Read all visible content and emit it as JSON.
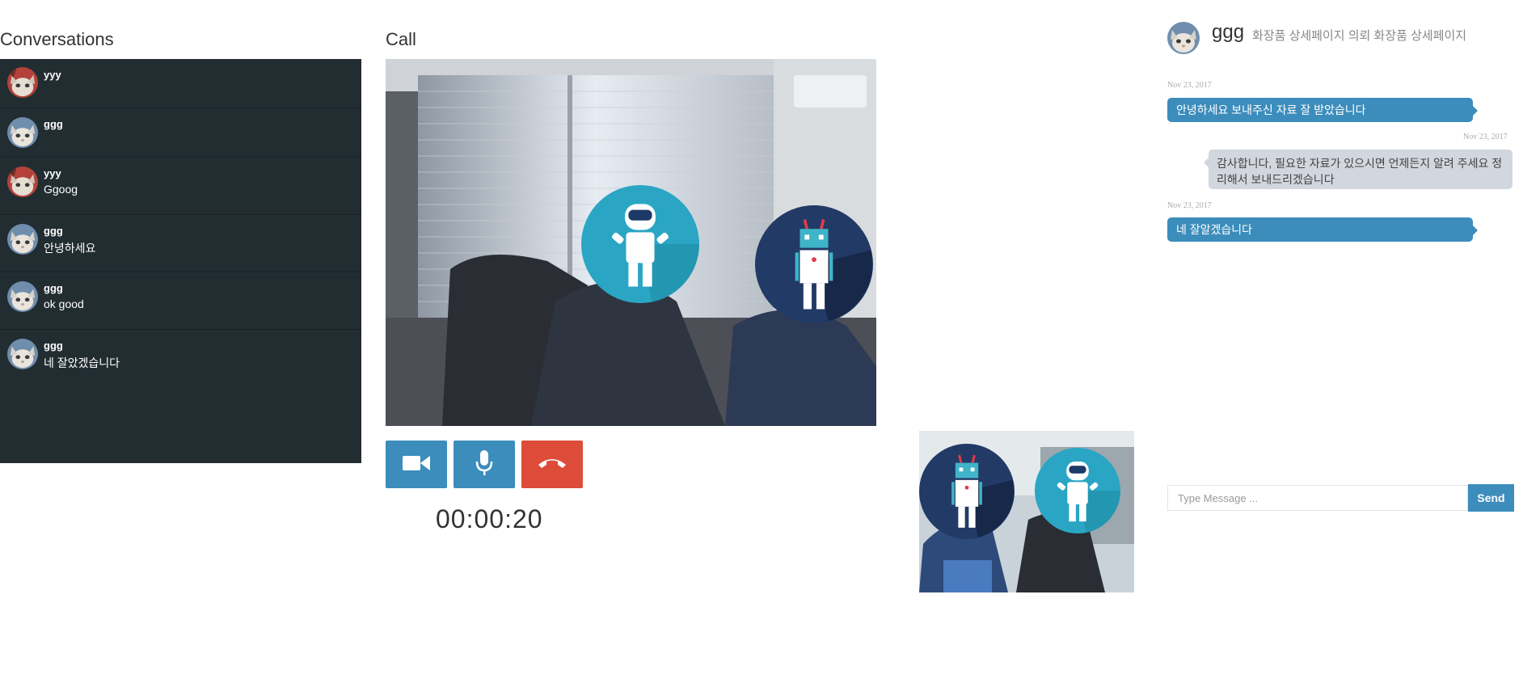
{
  "conversations": {
    "title": "Conversations",
    "items": [
      {
        "name": "yyy",
        "message": "",
        "avatar": "cat-avatar-red"
      },
      {
        "name": "ggg",
        "message": "",
        "avatar": "cat-avatar-blue"
      },
      {
        "name": "yyy",
        "message": "Ggoog",
        "avatar": "cat-avatar-red"
      },
      {
        "name": "ggg",
        "message": "안녕하세요",
        "avatar": "cat-avatar-blue"
      },
      {
        "name": "ggg",
        "message": "ok good",
        "avatar": "cat-avatar-blue"
      },
      {
        "name": "ggg",
        "message": "네 잘았겠습니다",
        "avatar": "cat-avatar-blue"
      }
    ]
  },
  "call": {
    "title": "Call",
    "timer": "00:00:20",
    "buttons": [
      {
        "icon": "video-camera-icon",
        "color": "#3c8dbc"
      },
      {
        "icon": "microphone-icon",
        "color": "#3c8dbc"
      },
      {
        "icon": "hang-up-phone-icon",
        "color": "#dd4b39"
      }
    ]
  },
  "chat": {
    "name": "ggg",
    "subtitle": "화장품 상세페이지 의뢰 화장품 상세페이지",
    "messages": [
      {
        "direction": "in",
        "time": "Nov 23, 2017",
        "text": "안녕하세요 보내주신 자료 잘 받았습니다"
      },
      {
        "direction": "out",
        "time": "Nov 23, 2017",
        "text": "감사합니다, 필요한 자료가 있으시면 언제든지 알려 주세요 정리해서 보내드리겠습니다"
      },
      {
        "direction": "in",
        "time": "Nov 23, 2017",
        "text": "네 잘알겠습니다"
      }
    ],
    "input_placeholder": "Type Message ...",
    "send_label": "Send"
  },
  "colors": {
    "primary": "#3c8dbc",
    "danger": "#dd4b39",
    "sidebar_bg": "#222d32",
    "bubble_out": "#d2d6de"
  }
}
